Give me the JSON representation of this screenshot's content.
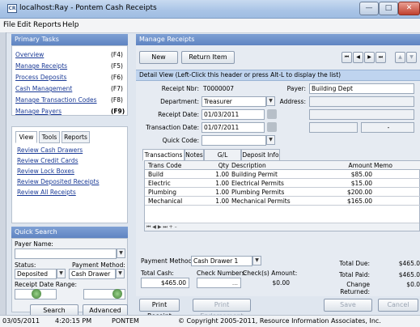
{
  "window": {
    "title": "localhost:Ray - Pontem Cash Receipts",
    "app_icon": "CR"
  },
  "menu": [
    "File",
    "Edit",
    "Reports",
    "Help"
  ],
  "primary_tasks": {
    "title": "Primary Tasks",
    "items": [
      {
        "label": "Overview",
        "key": "(F4)"
      },
      {
        "label": "Manage Receipts",
        "key": "(F5)"
      },
      {
        "label": "Process Deposits",
        "key": "(F6)"
      },
      {
        "label": "Cash Management",
        "key": "(F7)"
      },
      {
        "label": "Manage Transaction Codes",
        "key": "(F8)"
      },
      {
        "label": "Manage Payers",
        "key": "(F9)"
      }
    ]
  },
  "left_tabs": [
    "View",
    "Tools",
    "Reports"
  ],
  "review_links": [
    "Review Cash Drawers",
    "Review Credit Cards",
    "Review Lock Boxes",
    "Review Deposited Receipts",
    "Review All Receipts"
  ],
  "quick_search": {
    "title": "Quick Search",
    "payer_label": "Payer Name:",
    "status_label": "Status:",
    "status_value": "Deposited",
    "payment_method_label": "Payment Method:",
    "payment_method_value": "Cash Drawer",
    "receipt_date_range_label": "Receipt Date Range:",
    "search_button": "Search",
    "advanced_button": "Advanced"
  },
  "main": {
    "title": "Manage Receipts",
    "new_button": "New",
    "return_item_button": "Return Item",
    "detail_header": "Detail View (Left-Click this header or press Alt-L to display the list)",
    "receipt_nbr_label": "Receipt Nbr:",
    "receipt_nbr": "T0000007",
    "department_label": "Department:",
    "department": "Treasurer",
    "receipt_date_label": "Receipt Date:",
    "receipt_date": "01/03/2011",
    "transaction_date_label": "Transaction Date:",
    "transaction_date": "01/07/2011",
    "quick_code_label": "Quick Code:",
    "payer_label": "Payer:",
    "payer": "Building Dept",
    "address_label": "Address:",
    "address_dash": "-",
    "tabs": [
      "Transactions",
      "Notes",
      "G/L Preview",
      "Deposit Info"
    ],
    "columns": [
      "Trans Code",
      "Qty",
      "Description",
      "Amount",
      "Memo"
    ],
    "rows": [
      {
        "code": "Build",
        "qty": "1.00",
        "desc": "Building Permit",
        "amount": "$85.00"
      },
      {
        "code": "Electric",
        "qty": "1.00",
        "desc": "Electrical Permits",
        "amount": "$15.00"
      },
      {
        "code": "Plumbing",
        "qty": "1.00",
        "desc": "Plumbing Permits",
        "amount": "$200.00"
      },
      {
        "code": "Mechanical",
        "qty": "1.00",
        "desc": "Mechanical Permits",
        "amount": "$165.00"
      }
    ],
    "payment_method_label": "Payment Method:",
    "payment_method": "Cash Drawer 1",
    "total_cash_label": "Total Cash:",
    "total_cash": "$465.00",
    "check_numbers_label": "Check Numbers:",
    "checks_amount_label": "Check(s) Amount:",
    "checks_amount": "$0.00",
    "total_due_label": "Total Due:",
    "total_due": "$465.0",
    "total_paid_label": "Total Paid:",
    "total_paid": "$465.0",
    "change_returned_label": "Change Returned:",
    "change_returned": "$0.0",
    "print_receipt": "Print Receipt",
    "print_endorsement": "Print Endorsement",
    "save": "Save",
    "cancel": "Cancel"
  },
  "status_bar": {
    "date": "03/05/2011",
    "time": "4:20:15 PM",
    "user": "PONTEM",
    "copyright": "© Copyright 2005-2011, Resource Information Associates, Inc."
  }
}
